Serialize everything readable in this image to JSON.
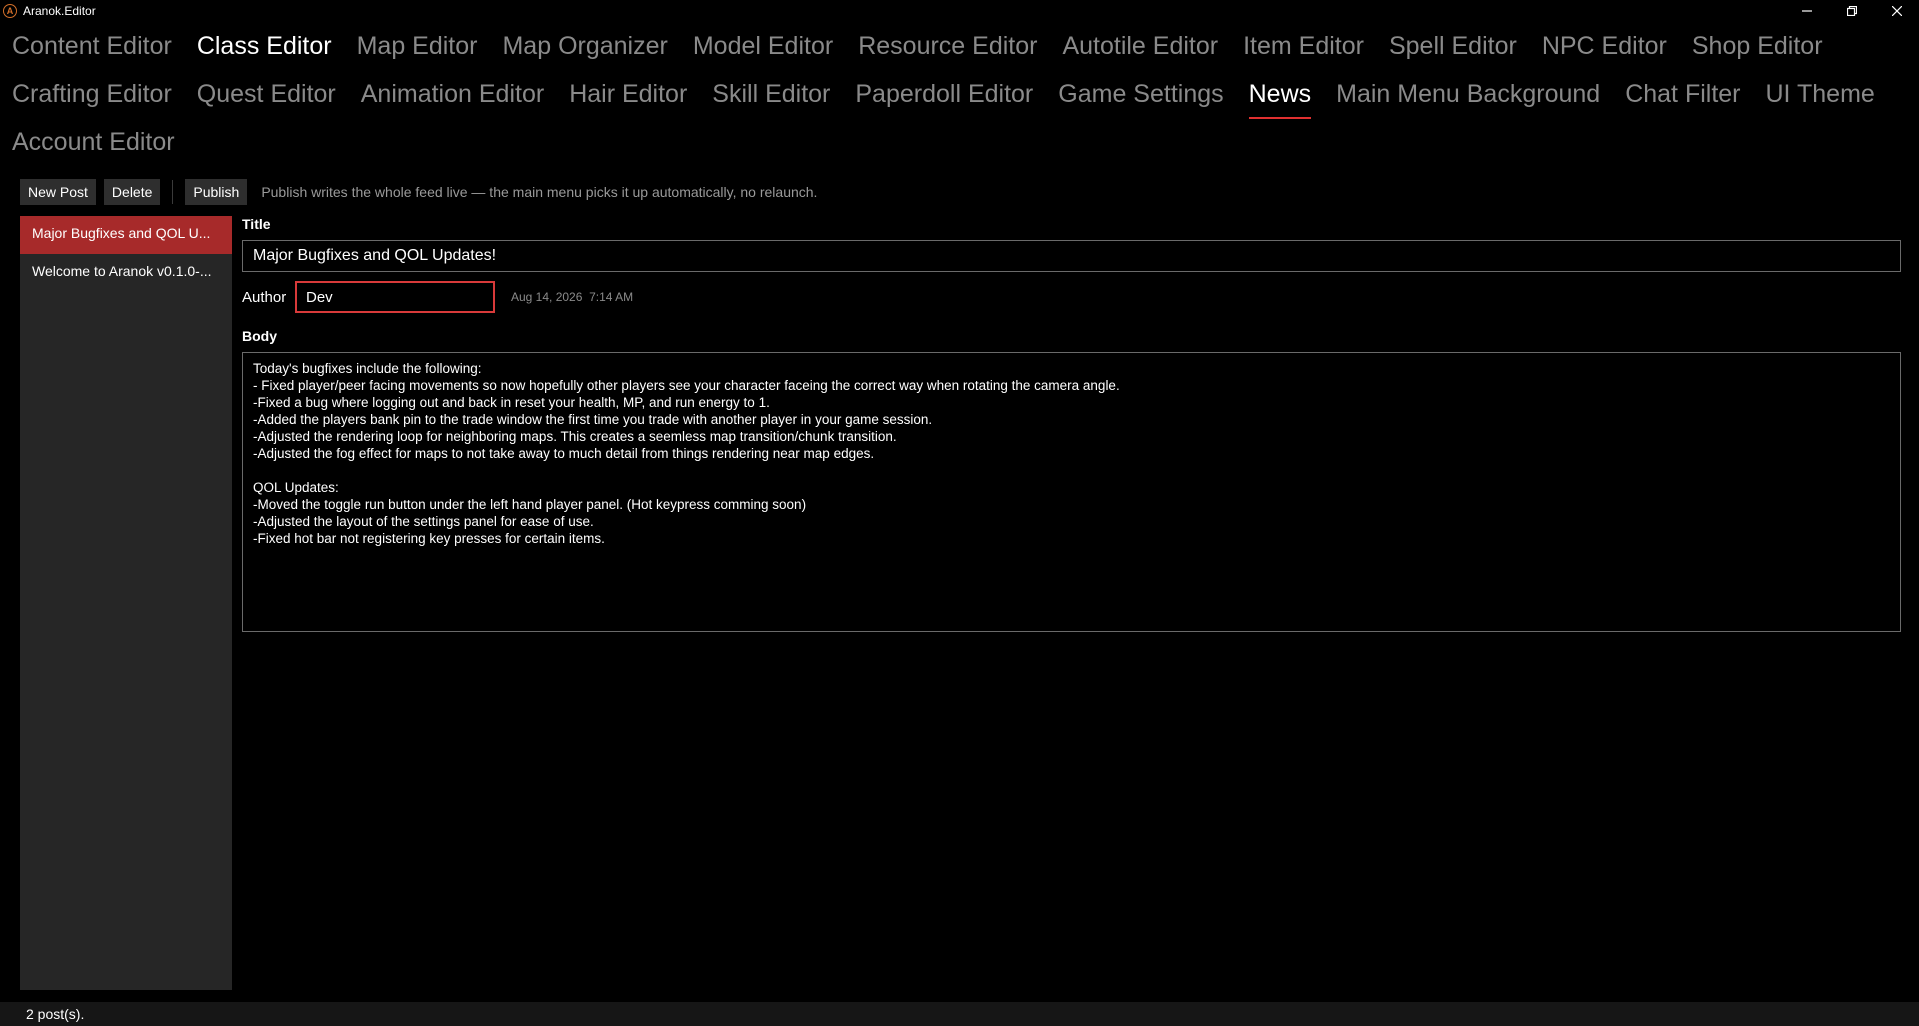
{
  "window": {
    "title": "Aranok.Editor",
    "icon": "aranok-logo-icon"
  },
  "tabs": [
    {
      "label": "Content Editor",
      "state": "normal"
    },
    {
      "label": "Class Editor",
      "state": "bright"
    },
    {
      "label": "Map Editor",
      "state": "normal"
    },
    {
      "label": "Map Organizer",
      "state": "normal"
    },
    {
      "label": "Model Editor",
      "state": "normal"
    },
    {
      "label": "Resource Editor",
      "state": "normal"
    },
    {
      "label": "Autotile Editor",
      "state": "normal"
    },
    {
      "label": "Item Editor",
      "state": "normal"
    },
    {
      "label": "Spell Editor",
      "state": "normal"
    },
    {
      "label": "NPC Editor",
      "state": "normal"
    },
    {
      "label": "Shop Editor",
      "state": "normal"
    },
    {
      "label": "Crafting Editor",
      "state": "normal"
    },
    {
      "label": "Quest Editor",
      "state": "normal"
    },
    {
      "label": "Animation Editor",
      "state": "normal"
    },
    {
      "label": "Hair Editor",
      "state": "normal"
    },
    {
      "label": "Skill Editor",
      "state": "normal"
    },
    {
      "label": "Paperdoll Editor",
      "state": "normal"
    },
    {
      "label": "Game Settings",
      "state": "normal"
    },
    {
      "label": "News",
      "state": "active"
    },
    {
      "label": "Main Menu Background",
      "state": "normal"
    },
    {
      "label": "Chat Filter",
      "state": "normal"
    },
    {
      "label": "UI Theme",
      "state": "normal"
    },
    {
      "label": "Account Editor",
      "state": "normal"
    }
  ],
  "toolbar": {
    "new_post": "New Post",
    "delete": "Delete",
    "publish": "Publish",
    "hint": "Publish writes the whole feed live — the main menu picks it up automatically, no relaunch."
  },
  "posts": [
    {
      "label": "Major Bugfixes and QOL U...",
      "selected": true
    },
    {
      "label": "Welcome to Aranok v0.1.0-...",
      "selected": false
    }
  ],
  "form": {
    "title_label": "Title",
    "title_value": "Major Bugfixes and QOL Updates!",
    "author_label": "Author",
    "author_value": "Dev",
    "date": "Aug 14, 2026  7:14 AM",
    "body_label": "Body",
    "body_lines": [
      "Today's bugfixes include the following:",
      "- Fixed player/peer facing movements so now hopefully other players see your character faceing the correct way when rotating the camera angle.",
      "-Fixed a bug where logging out and back in reset your health, MP, and run energy to 1.",
      "-Added the players bank pin to the trade window the first time you trade with another player in your game session.",
      "-Adjusted the rendering loop for neighboring maps. This creates a seemless map transition/chunk transition.",
      "-Adjusted the fog effect for maps to not take away to much detail from things rendering near map edges.",
      "",
      "QOL Updates:",
      "-Moved the toggle run button under the left hand player panel. (Hot keypress comming soon)",
      "-Adjusted the layout of the settings panel for ease of use.",
      "-Fixed hot bar not registering key presses for certain items."
    ]
  },
  "status": {
    "text": "2 post(s)."
  },
  "colors": {
    "accent": "#e03030",
    "selected": "#a72a2a",
    "background": "#000000"
  }
}
